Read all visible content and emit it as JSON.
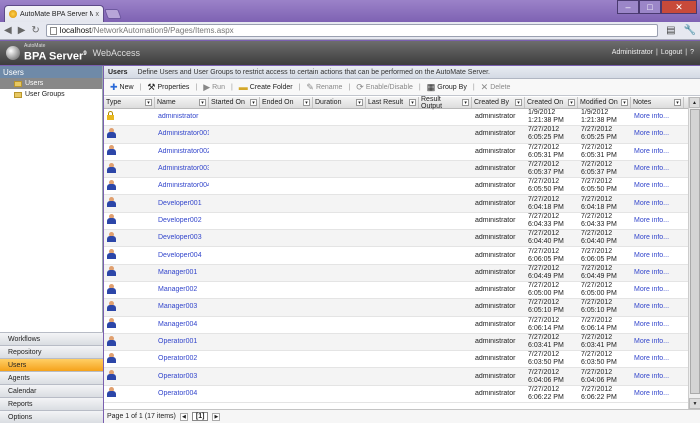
{
  "browser": {
    "tab_title": "AutoMate BPA Server Man",
    "tab_close": "x",
    "url_host": "localhost",
    "url_path": "/NetworkAutomation9/Pages/Items.aspx",
    "win_min": "–",
    "win_max": "□",
    "win_close": "✕"
  },
  "app": {
    "logo_top": "AutoMate",
    "logo_main": "BPA Server",
    "logo_version": "9",
    "logo_sub": "WebAccess",
    "user": "Administrator",
    "logout": "Logout",
    "help": "?",
    "sep": "|"
  },
  "sidebar": {
    "header": "Users",
    "tree": [
      {
        "label": "Users",
        "selected": true
      },
      {
        "label": "User Groups",
        "selected": false
      }
    ],
    "nav": [
      "Workflows",
      "Repository",
      "Users",
      "Agents",
      "Calendar",
      "Reports",
      "Options"
    ],
    "active_nav": "Users"
  },
  "section": {
    "title": "Users",
    "description": "Define Users and User Groups to restrict access to certain actions that can be performed on the AutoMate Server."
  },
  "toolbar": {
    "new": "New",
    "properties": "Properties",
    "run": "Run",
    "create_folder": "Create Folder",
    "rename": "Rename",
    "enable_disable": "Enable/Disable",
    "group_by": "Group By",
    "delete": "Delete"
  },
  "columns": [
    "Type",
    "Name",
    "Started On",
    "Ended On",
    "Duration",
    "Last Result",
    "Result Output",
    "Created By",
    "Created On",
    "Modified On",
    "Notes"
  ],
  "rows": [
    {
      "type": "lock",
      "name": "administrator",
      "created_by": "administrator",
      "created_date": "1/9/2012",
      "created_time": "1:21:38 PM",
      "modified_date": "1/9/2012",
      "modified_time": "1:21:38 PM",
      "notes": "More info..."
    },
    {
      "type": "user",
      "name": "Administrator001",
      "created_by": "administrator",
      "created_date": "7/27/2012",
      "created_time": "6:05:25 PM",
      "modified_date": "7/27/2012",
      "modified_time": "6:05:25 PM",
      "notes": "More info..."
    },
    {
      "type": "user",
      "name": "Administrator002",
      "created_by": "administrator",
      "created_date": "7/27/2012",
      "created_time": "6:05:31 PM",
      "modified_date": "7/27/2012",
      "modified_time": "6:05:31 PM",
      "notes": "More info..."
    },
    {
      "type": "user",
      "name": "Administrator003",
      "created_by": "administrator",
      "created_date": "7/27/2012",
      "created_time": "6:05:37 PM",
      "modified_date": "7/27/2012",
      "modified_time": "6:05:37 PM",
      "notes": "More info..."
    },
    {
      "type": "user",
      "name": "Administrator004",
      "created_by": "administrator",
      "created_date": "7/27/2012",
      "created_time": "6:05:50 PM",
      "modified_date": "7/27/2012",
      "modified_time": "6:05:50 PM",
      "notes": "More info..."
    },
    {
      "type": "user",
      "name": "Developer001",
      "created_by": "administrator",
      "created_date": "7/27/2012",
      "created_time": "6:04:18 PM",
      "modified_date": "7/27/2012",
      "modified_time": "6:04:18 PM",
      "notes": "More info..."
    },
    {
      "type": "user",
      "name": "Developer002",
      "created_by": "administrator",
      "created_date": "7/27/2012",
      "created_time": "6:04:33 PM",
      "modified_date": "7/27/2012",
      "modified_time": "6:04:33 PM",
      "notes": "More info..."
    },
    {
      "type": "user",
      "name": "Developer003",
      "created_by": "administrator",
      "created_date": "7/27/2012",
      "created_time": "6:04:40 PM",
      "modified_date": "7/27/2012",
      "modified_time": "6:04:40 PM",
      "notes": "More info..."
    },
    {
      "type": "user",
      "name": "Developer004",
      "created_by": "administrator",
      "created_date": "7/27/2012",
      "created_time": "6:06:05 PM",
      "modified_date": "7/27/2012",
      "modified_time": "6:06:05 PM",
      "notes": "More info..."
    },
    {
      "type": "user",
      "name": "Manager001",
      "created_by": "administrator",
      "created_date": "7/27/2012",
      "created_time": "6:04:49 PM",
      "modified_date": "7/27/2012",
      "modified_time": "6:04:49 PM",
      "notes": "More info..."
    },
    {
      "type": "user",
      "name": "Manager002",
      "created_by": "administrator",
      "created_date": "7/27/2012",
      "created_time": "6:05:00 PM",
      "modified_date": "7/27/2012",
      "modified_time": "6:05:00 PM",
      "notes": "More info..."
    },
    {
      "type": "user",
      "name": "Manager003",
      "created_by": "administrator",
      "created_date": "7/27/2012",
      "created_time": "6:05:10 PM",
      "modified_date": "7/27/2012",
      "modified_time": "6:05:10 PM",
      "notes": "More info..."
    },
    {
      "type": "user",
      "name": "Manager004",
      "created_by": "administrator",
      "created_date": "7/27/2012",
      "created_time": "6:06:14 PM",
      "modified_date": "7/27/2012",
      "modified_time": "6:06:14 PM",
      "notes": "More info..."
    },
    {
      "type": "user",
      "name": "Operator001",
      "created_by": "administrator",
      "created_date": "7/27/2012",
      "created_time": "6:03:41 PM",
      "modified_date": "7/27/2012",
      "modified_time": "6:03:41 PM",
      "notes": "More info..."
    },
    {
      "type": "user",
      "name": "Operator002",
      "created_by": "administrator",
      "created_date": "7/27/2012",
      "created_time": "6:03:50 PM",
      "modified_date": "7/27/2012",
      "modified_time": "6:03:50 PM",
      "notes": "More info..."
    },
    {
      "type": "user",
      "name": "Operator003",
      "created_by": "administrator",
      "created_date": "7/27/2012",
      "created_time": "6:04:06 PM",
      "modified_date": "7/27/2012",
      "modified_time": "6:04:06 PM",
      "notes": "More info..."
    },
    {
      "type": "user",
      "name": "Operator004",
      "created_by": "administrator",
      "created_date": "7/27/2012",
      "created_time": "6:06:22 PM",
      "modified_date": "7/27/2012",
      "modified_time": "6:06:22 PM",
      "notes": "More info..."
    }
  ],
  "pager": {
    "summary": "Page 1 of 1 (17 items)",
    "current": "[1]",
    "prev": "◀",
    "next": "▶"
  },
  "colors": {
    "accent": "#f5a21b",
    "link": "#3346cc",
    "header": "#6f8aa8"
  }
}
